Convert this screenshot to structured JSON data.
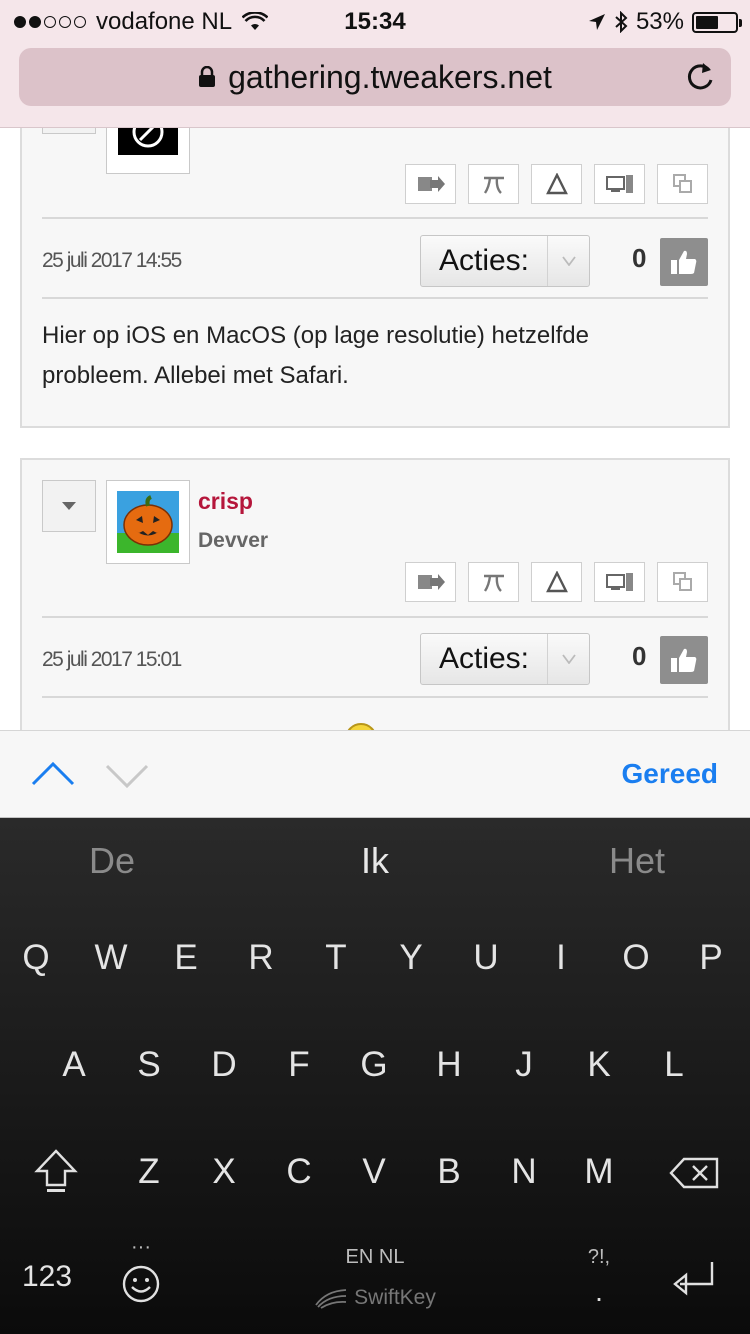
{
  "status_bar": {
    "carrier": "vodafone NL",
    "time": "15:34",
    "battery": "53%",
    "battery_level": 0.53
  },
  "browser": {
    "url": "gathering.tweakers.net"
  },
  "posts": [
    {
      "date": "25 juli 2017 14:55",
      "actions_label": "Acties:",
      "score": "0",
      "body": "Hier op iOS en MacOS (op lage resolutie) hetzelfde probleem. Allebei met Safari."
    },
    {
      "username": "crisp",
      "user_title": "Devver",
      "date": "25 juli 2017 15:01",
      "actions_label": "Acties:",
      "score": "0"
    }
  ],
  "toolbar_icons": [
    "quote-icon",
    "pi-icon",
    "delta-icon",
    "devices-icon",
    "copy-icon"
  ],
  "form_accessory": {
    "done_label": "Gereed"
  },
  "keyboard": {
    "predictions": [
      "De",
      "Ik",
      "Het"
    ],
    "row1": [
      "Q",
      "W",
      "E",
      "R",
      "T",
      "Y",
      "U",
      "I",
      "O",
      "P"
    ],
    "row2": [
      "A",
      "S",
      "D",
      "F",
      "G",
      "H",
      "J",
      "K",
      "L"
    ],
    "row3": [
      "Z",
      "X",
      "C",
      "V",
      "B",
      "N",
      "M"
    ],
    "numbers_label": "123",
    "emoji_more": "···",
    "language_label": "EN NL",
    "brand_label": "SwiftKey",
    "punct_label": "?!,",
    "period_label": "."
  },
  "colors": {
    "accent_blue": "#1a7ef0",
    "username_red": "#b5163b",
    "browser_bar": "#f5e6ea"
  }
}
